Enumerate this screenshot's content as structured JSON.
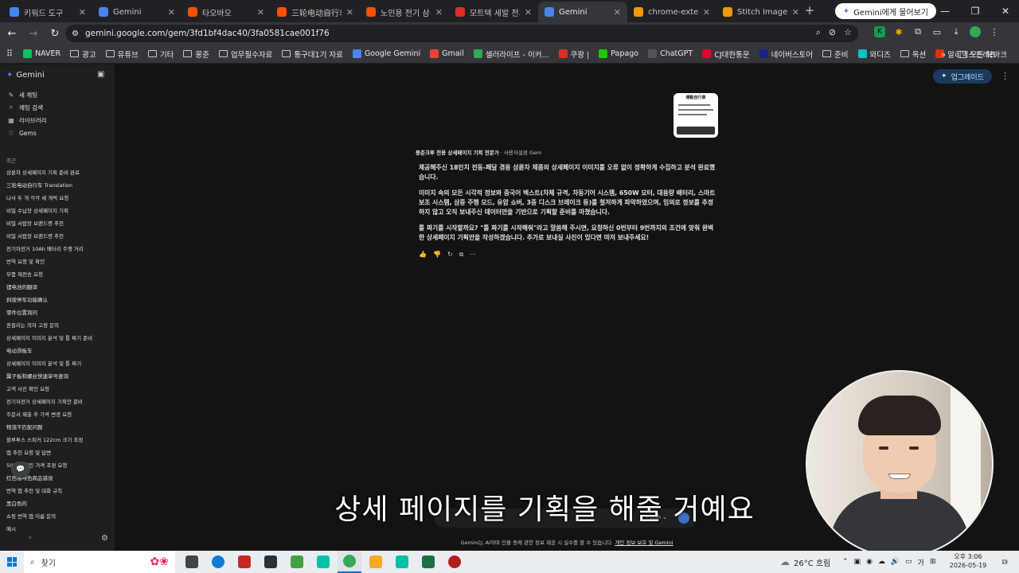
{
  "browser": {
    "tabs": [
      {
        "label": "키워드 도구",
        "color": "#4285f4",
        "active": false
      },
      {
        "label": "Gemini",
        "color": "#4e82ee",
        "active": false
      },
      {
        "label": "타오바오",
        "color": "#ff5000",
        "active": false
      },
      {
        "label": "三轮电动自行车_",
        "color": "#ff5000",
        "active": false
      },
      {
        "label": "노인용 전기 삼륜",
        "color": "#ff5000",
        "active": false
      },
      {
        "label": "모트텍 세발 전기",
        "color": "#d93025",
        "active": false
      },
      {
        "label": "Gemini",
        "color": "#4e82ee",
        "active": true
      },
      {
        "label": "chrome-extension",
        "color": "#f29900",
        "active": false
      },
      {
        "label": "Stitch Images",
        "color": "#f29900",
        "active": false
      }
    ],
    "ask_gemini": "Gemini에게 물어보기",
    "url": "gemini.google.com/gem/3fd1bf4dac40/3fa0581cae001f76",
    "bookmarks": [
      {
        "label": "NAVER",
        "kind": "icon",
        "color": "#03c75a"
      },
      {
        "label": "광고",
        "kind": "folder"
      },
      {
        "label": "유튜브",
        "kind": "folder"
      },
      {
        "label": "기타",
        "kind": "folder"
      },
      {
        "label": "몽준",
        "kind": "folder"
      },
      {
        "label": "업무필수자료",
        "kind": "folder"
      },
      {
        "label": "통구대1기 자료",
        "kind": "folder"
      },
      {
        "label": "Google Gemini",
        "kind": "icon",
        "color": "#4e82ee"
      },
      {
        "label": "Gmail",
        "kind": "icon",
        "color": "#ea4335"
      },
      {
        "label": "셀러라이프 - 이커...",
        "kind": "icon",
        "color": "#34a853"
      },
      {
        "label": "쿠팡 |",
        "kind": "icon",
        "color": "#d93025"
      },
      {
        "label": "Papago",
        "kind": "icon",
        "color": "#1ec800"
      },
      {
        "label": "ChatGPT",
        "kind": "icon",
        "color": "#555555"
      },
      {
        "label": "CJ대한통운",
        "kind": "icon",
        "color": "#e4002b"
      },
      {
        "label": "네이버스토어",
        "kind": "icon",
        "color": "#1a237e"
      },
      {
        "label": "준비",
        "kind": "folder"
      },
      {
        "label": "와디즈",
        "kind": "icon",
        "color": "#00c4c4"
      },
      {
        "label": "옥션",
        "kind": "folder"
      },
      {
        "label": "알리익스프레스",
        "kind": "icon",
        "color": "#e62e04"
      }
    ],
    "all_bookmarks": "모든 북마크"
  },
  "sidebar": {
    "brand": "Gemini",
    "nav": [
      {
        "label": "새 채팅",
        "icon": "edit-icon",
        "glyph": "✎"
      },
      {
        "label": "채팅 검색",
        "icon": "search-icon",
        "glyph": "⌕"
      },
      {
        "label": "라이브러리",
        "icon": "library-icon",
        "glyph": "▦"
      },
      {
        "label": "Gems",
        "icon": "gem-icon",
        "glyph": "♡"
      }
    ],
    "recent_label": "최근",
    "recent": [
      "삼륜차 상세페이지 기획 준비 완료",
      "三轮电动自行车 Translation",
      "나사 두 개 각각 세 개씩 요청",
      "비밀 수납장 상세페이지 기획",
      "비밀 서랍장 브랜드명 추천",
      "비밀 서랍장 브랜드명 추천",
      "전기자전거 10Ah 배터리 주행 거리",
      "번역 요청 및 확인",
      "부품 재전송 요청",
      "锂电池的翻译",
      "斜坡停车功能确认",
      "零件位置询问",
      "흔들리는 의자 고정 문의",
      "상세페이지 이미지 분석 및 틀 짜기 준비",
      "电动滑板车",
      "상세페이지 이미지 분석 및 틀 짜기",
      "翼子板和螺丝快速单号查询",
      "고객 사진 확인 요청",
      "전기자전거 상세페이지 기획안 준비",
      "주문서 제출 후 가격 변경 요청",
      "物流不匹配问题",
      "블루투스 스피커 122cm 크기 조정",
      "앱 추천 요청 및 답변",
      "50위안 할인 가격 조정 요청",
      "红色咖啡色商品错误",
      "번역 앱 추천 및 대화 규칙",
      "黑白色的",
      "쇼핑 번역 앱 이름 문의",
      "예시"
    ]
  },
  "main": {
    "upgrade": "업그레이드",
    "thumb_title": "傳動自行車",
    "gem_name": "몽준크루 전용 상세페이지 기획 전문가",
    "gem_suffix": " · 사용자설정 Gem",
    "paragraphs": [
      "제공해주신 18인치 전동-페달 겸용 삼륜차 제품의 상세페이지 이미지를 오류 없이 정확하게 수집하고 분석 완료했습니다.",
      "이미지 속의 모든 시각적 정보와 중국어 텍스트(차체 규격, 차동기어 시스템, 650W 모터, 대용량 배터리, 스마트 보조 시스템, 삼중 주행 모드, 유압 쇼버, 3중 디스크 브레이크 등)를 철저하게 파악하였으며, 임의로 정보를 추정하지 않고 오직 보내주신 데이터만을 기반으로 기획할 준비를 마쳤습니다.",
      "틀 짜기를 시작할까요? \"틀 짜기를 시작해줘\"라고 말씀해 주시면, 요청하신 0번부터 9번까지의 조건에 맞춰 완벽한 상세페이지 기획안을 작성하겠습니다. 추가로 보내실 사진이 있다면 마저 보내주세요!"
    ],
    "model": "Flash",
    "disclaimer_prefix": "Gemini는 AI이며 인물 등에 관한 정보 제공 시 실수를 할 수 있습니다. ",
    "disclaimer_link": "개인 정보 보호 및 Gemini",
    "subtitle": "상세 페이지를 기획을 해줄 거예요"
  },
  "taskbar": {
    "search": "찾기",
    "apps": [
      {
        "icon": "task-view-icon",
        "color": "#444444"
      },
      {
        "icon": "edge-icon",
        "color": "#0f7bd7"
      },
      {
        "icon": "app-red-icon",
        "color": "#c62828"
      },
      {
        "icon": "app-dark-icon",
        "color": "#263238"
      },
      {
        "icon": "app-green-icon",
        "color": "#43a047"
      },
      {
        "icon": "app-teal-icon",
        "color": "#00c4a7"
      },
      {
        "icon": "chrome-icon",
        "color": "#34a853"
      },
      {
        "icon": "explorer-icon",
        "color": "#f9a825"
      },
      {
        "icon": "app-mint-icon",
        "color": "#00bfa5"
      },
      {
        "icon": "excel-icon",
        "color": "#1d6f42"
      },
      {
        "icon": "app-recorder-icon",
        "color": "#b71c1c"
      }
    ],
    "weather": "26°C 흐림",
    "lang": "가",
    "time": "오후 3:06",
    "date": "2026-05-19",
    "notifications": "19"
  }
}
